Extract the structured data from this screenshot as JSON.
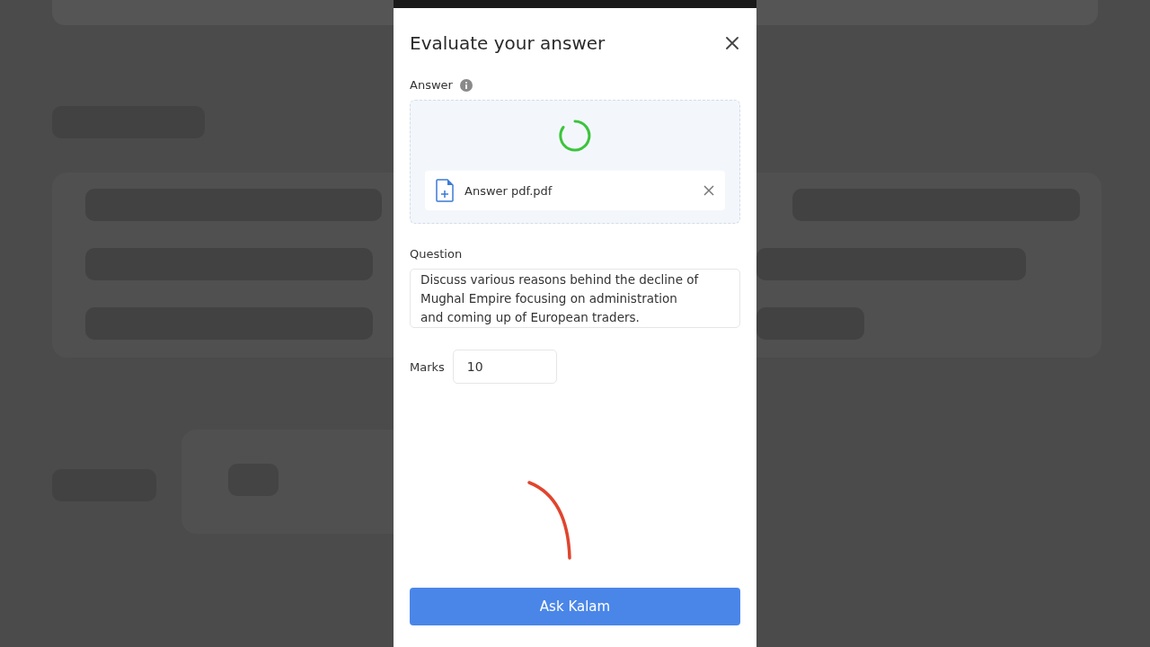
{
  "dialog": {
    "title": "Evaluate your answer"
  },
  "answer": {
    "label": "Answer",
    "loading": true,
    "file_name": "Answer pdf.pdf"
  },
  "question": {
    "label": "Question",
    "value": "Discuss various reasons behind the decline of\nMughal Empire focusing on administration\nand coming up of European traders."
  },
  "marks": {
    "label": "Marks",
    "value": "10"
  },
  "submit": {
    "label": "Ask Kalam"
  }
}
